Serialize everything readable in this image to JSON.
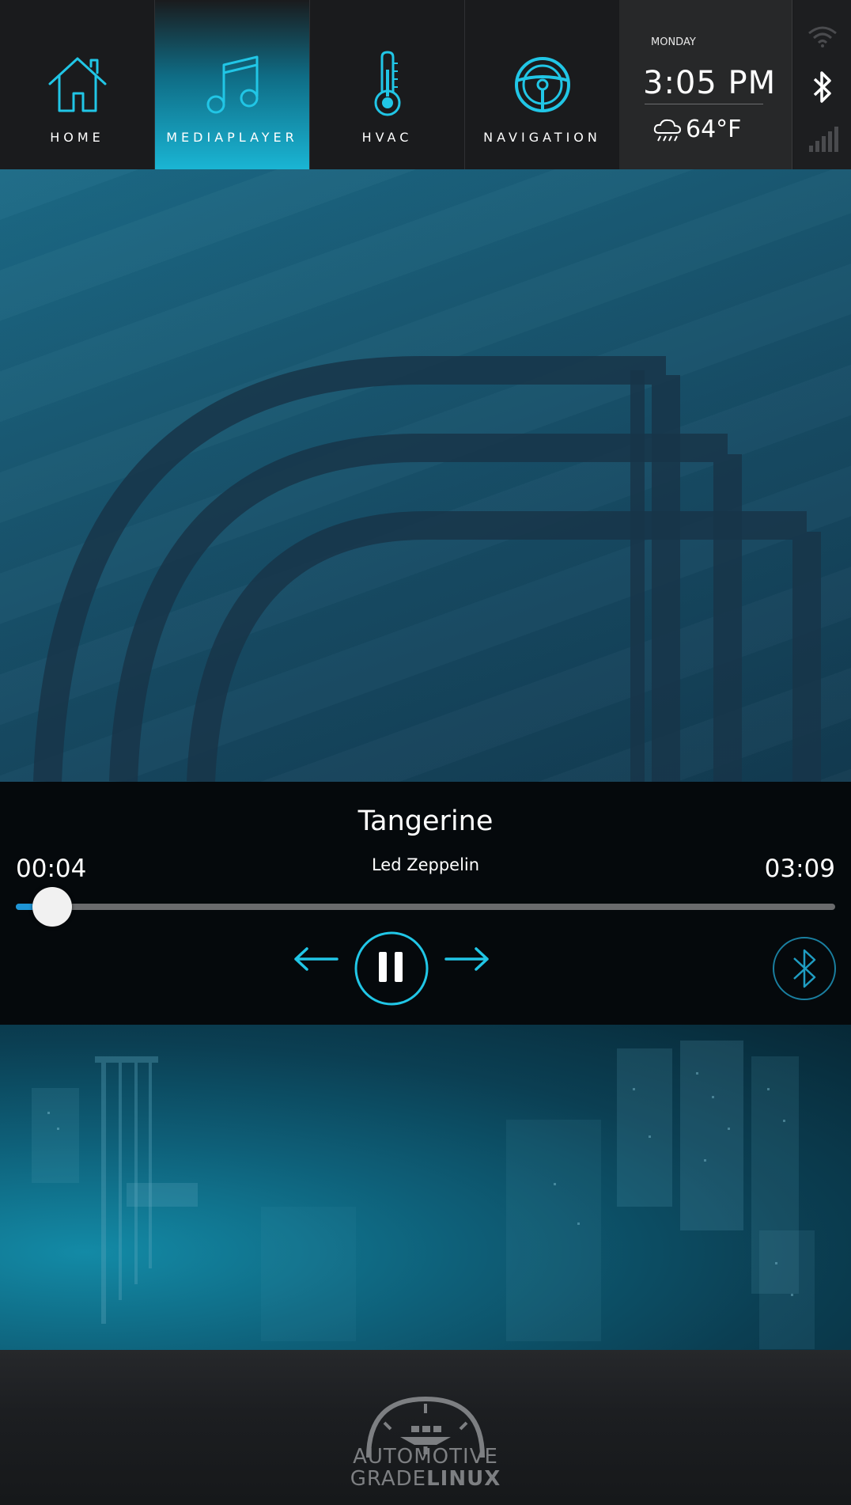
{
  "nav": {
    "tabs": [
      {
        "label": "HOME",
        "icon": "home-icon",
        "active": false
      },
      {
        "label": "MEDIAPLAYER",
        "icon": "music-note-icon",
        "active": true
      },
      {
        "label": "HVAC",
        "icon": "thermometer-icon",
        "active": false
      },
      {
        "label": "NAVIGATION",
        "icon": "steering-wheel-icon",
        "active": false
      }
    ]
  },
  "status": {
    "day": "MONDAY",
    "time": "3:05 PM",
    "temperature": "64°F",
    "weather_icon": "rain-cloud-icon"
  },
  "connectivity": {
    "wifi_icon": "wifi-icon",
    "bluetooth_icon": "bluetooth-icon",
    "signal_icon": "cellular-signal-icon"
  },
  "player": {
    "title": "Tangerine",
    "artist": "Led Zeppelin",
    "elapsed": "00:04",
    "duration": "03:09",
    "progress_fraction": 0.021,
    "state": "playing",
    "controls": {
      "previous_icon": "arrow-left-icon",
      "pause_icon": "pause-icon",
      "next_icon": "arrow-right-icon",
      "source_icon": "bluetooth-icon"
    }
  },
  "footer": {
    "logo_line1": "AUTOMOTIVE",
    "logo_line2_light": "GRADE",
    "logo_line2_bold": "LINUX"
  },
  "colors": {
    "accent": "#21c6e6",
    "progress": "#1e95d6",
    "topbar_bg": "#1a1b1d",
    "player_bg": "#05090c"
  }
}
